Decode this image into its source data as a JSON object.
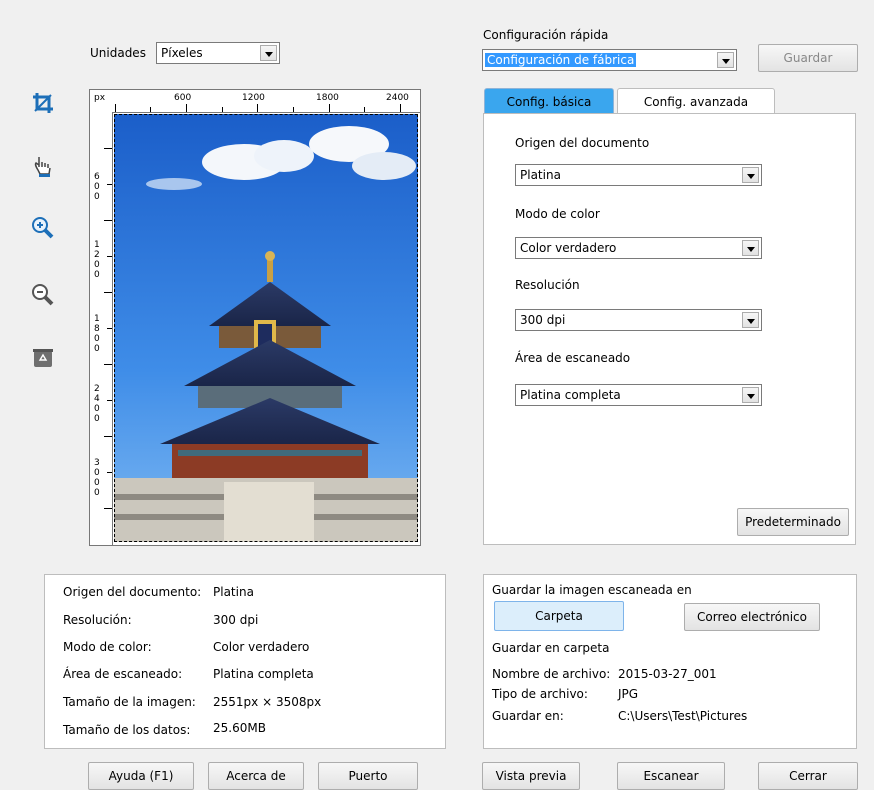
{
  "units": {
    "label": "Unidades",
    "value": "Píxeles"
  },
  "quick_config": {
    "label": "Configuración rápida",
    "value": "Configuración de fábrica",
    "save_label": "Guardar"
  },
  "tools": [
    "crop-icon",
    "hand-pan-icon",
    "zoom-in-icon",
    "zoom-out-icon",
    "recycle-icon"
  ],
  "ruler": {
    "unit": "px",
    "top_ticks": [
      "600",
      "1200",
      "1800",
      "2400"
    ],
    "left_ticks": [
      "600",
      "1200",
      "1800",
      "2400",
      "3000"
    ]
  },
  "tabs": {
    "basic": "Config. básica",
    "advanced": "Config. avanzada",
    "active": "basic"
  },
  "basic": {
    "source_label": "Origen del documento",
    "source_value": "Platina",
    "color_label": "Modo de color",
    "color_value": "Color verdadero",
    "resolution_label": "Resolución",
    "resolution_value": "300 dpi",
    "area_label": "Área de escaneado",
    "area_value": "Platina completa",
    "default_button": "Predeterminado"
  },
  "info": {
    "rows": [
      {
        "label": "Origen del documento:",
        "value": "Platina"
      },
      {
        "label": "Resolución:",
        "value": "300 dpi"
      },
      {
        "label": "Modo de color:",
        "value": "Color verdadero"
      },
      {
        "label": "Área de escaneado:",
        "value": "Platina completa"
      },
      {
        "label": "Tamaño de la imagen:",
        "value": "2551px × 3508px"
      },
      {
        "label": "Tamaño de los datos:",
        "value": "25.60MB"
      }
    ]
  },
  "save": {
    "title": "Guardar la imagen escaneada en",
    "folder_button": "Carpeta",
    "email_button": "Correo electrónico",
    "folder_title": "Guardar en carpeta",
    "filename_label": "Nombre de archivo:",
    "filename_value": "2015-03-27_001",
    "filetype_label": "Tipo de archivo:",
    "filetype_value": "JPG",
    "saveto_label": "Guardar en:",
    "saveto_value": "C:\\Users\\Test\\Pictures"
  },
  "footer": {
    "help": "Ayuda (F1)",
    "about": "Acerca de",
    "port": "Puerto",
    "preview": "Vista previa",
    "scan": "Escanear",
    "close": "Cerrar"
  }
}
